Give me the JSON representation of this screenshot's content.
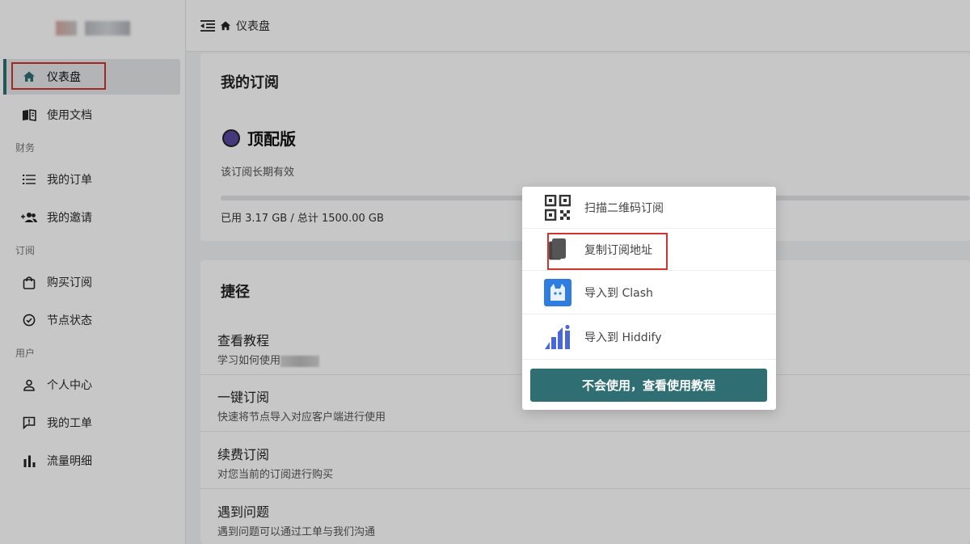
{
  "sidebar": {
    "nav_dashboard": "仪表盘",
    "nav_docs": "使用文档",
    "section_finance": "财务",
    "nav_orders": "我的订单",
    "nav_invite": "我的邀请",
    "section_subscription": "订阅",
    "nav_buy": "购买订阅",
    "nav_nodes": "节点状态",
    "section_user": "用户",
    "nav_profile": "个人中心",
    "nav_tickets": "我的工单",
    "nav_traffic": "流量明细"
  },
  "topbar": {
    "breadcrumb": "仪表盘",
    "icons": [
      "collapse-menu-icon",
      "home-icon"
    ]
  },
  "subscription": {
    "title": "我的订阅",
    "plan_name": "顶配版",
    "plan_validity": "该订阅长期有效",
    "usage_text": "已用 3.17 GB / 总计 1500.00 GB"
  },
  "shortcuts": {
    "title": "捷径",
    "items": [
      {
        "title": "查看教程",
        "subtitle": "学习如何使用"
      },
      {
        "title": "一键订阅",
        "subtitle": "快速将节点导入对应客户端进行使用"
      },
      {
        "title": "续费订阅",
        "subtitle": "对您当前的订阅进行购买"
      },
      {
        "title": "遇到问题",
        "subtitle": "遇到问题可以通过工单与我们沟通"
      }
    ]
  },
  "dialog": {
    "items": [
      {
        "label": "扫描二维码订阅",
        "icon": "qr-code-icon"
      },
      {
        "label": "复制订阅地址",
        "icon": "copy-icon"
      },
      {
        "label": "导入到 Clash",
        "icon": "clash-icon"
      },
      {
        "label": "导入到 Hiddify",
        "icon": "hiddify-icon"
      }
    ],
    "tutorial_button": "不会使用，查看使用教程"
  },
  "colors": {
    "accent": "#2f6f73",
    "highlight": "#d0342c",
    "plan_dot": "#5a4a9e"
  }
}
